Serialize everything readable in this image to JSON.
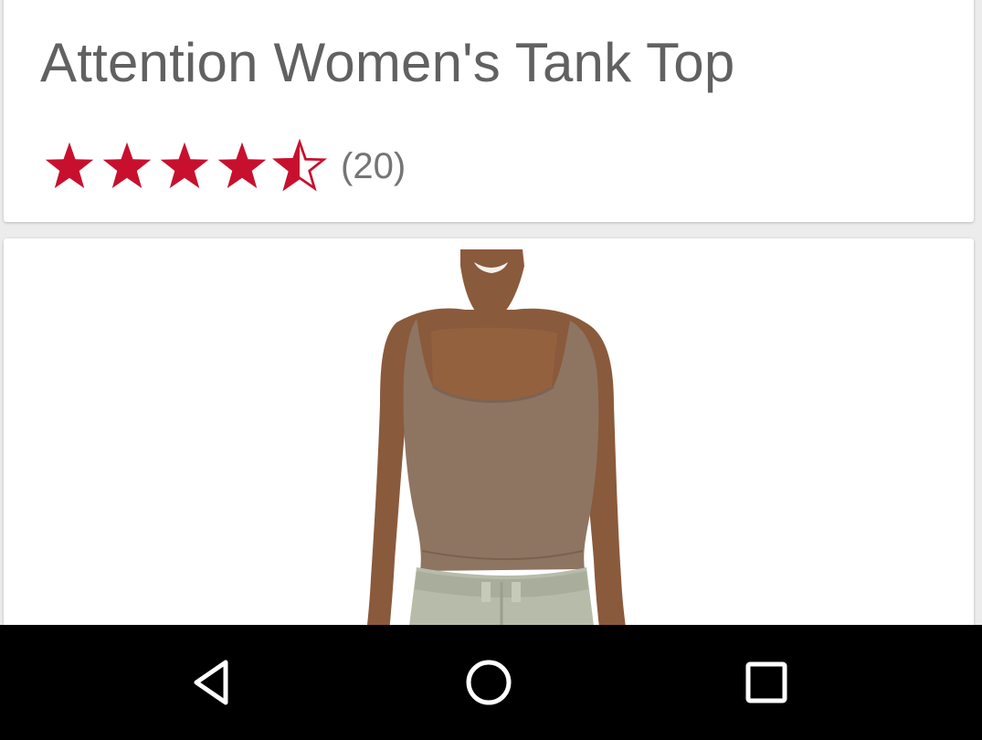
{
  "product": {
    "title": "Attention Women's Tank Top",
    "rating": 4.5,
    "rating_max": 5,
    "review_count": "(20)"
  },
  "image": {
    "alt": "Attention Women's Tank Top"
  },
  "colors": {
    "star": "#c8102e",
    "title_text": "#616161",
    "nav_background": "#000000",
    "nav_icon": "#ffffff"
  },
  "nav_bar": {
    "icons": [
      "back-icon",
      "home-icon",
      "recents-icon"
    ]
  }
}
